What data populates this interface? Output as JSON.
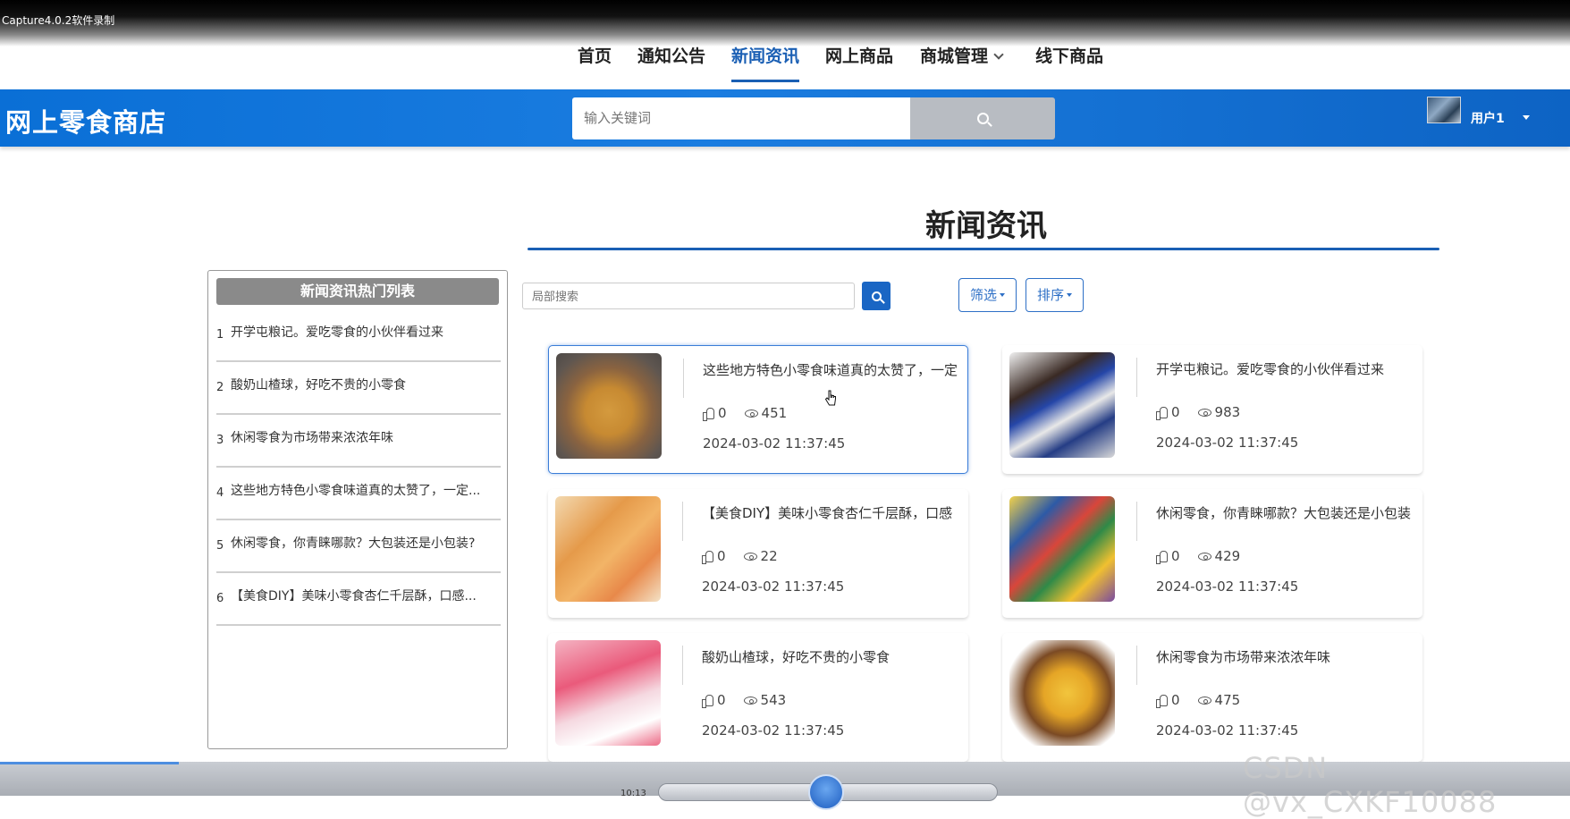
{
  "capture": {
    "title": "Capture4.0.2软件录制"
  },
  "topnav": {
    "items": [
      {
        "label": "首页"
      },
      {
        "label": "通知公告"
      },
      {
        "label": "新闻资讯"
      },
      {
        "label": "网上商品"
      },
      {
        "label": "商城管理"
      },
      {
        "label": "线下商品"
      }
    ],
    "active_index": 2
  },
  "header": {
    "brand": "网上零食商店",
    "search_placeholder": "输入关键词",
    "user_name": "用户1",
    "accent_color": "#0a6fd6"
  },
  "page": {
    "title": "新闻资讯"
  },
  "sidebar": {
    "title": "新闻资讯热门列表",
    "items": [
      {
        "num": "1",
        "text": "开学屯粮记。爱吃零食的小伙伴看过来"
      },
      {
        "num": "2",
        "text": "酸奶山楂球，好吃不贵的小零食"
      },
      {
        "num": "3",
        "text": "休闲零食为市场带来浓浓年味"
      },
      {
        "num": "4",
        "text": "这些地方特色小零食味道真的太赞了，一定..."
      },
      {
        "num": "5",
        "text": "休闲零食，你青睐哪款？大包装还是小包装?"
      },
      {
        "num": "6",
        "text": "【美食DIY】美味小零食杏仁千层酥，口感..."
      }
    ]
  },
  "filters": {
    "search_placeholder": "局部搜索",
    "filter_label": "筛选",
    "sort_label": "排序"
  },
  "news": [
    {
      "title": "这些地方特色小零食味道真的太赞了，一定",
      "likes": "0",
      "views": "451",
      "date": "2024-03-02 11:37:45"
    },
    {
      "title": "开学屯粮记。爱吃零食的小伙伴看过来",
      "likes": "0",
      "views": "983",
      "date": "2024-03-02 11:37:45"
    },
    {
      "title": "【美食DIY】美味小零食杏仁千层酥，口感",
      "likes": "0",
      "views": "22",
      "date": "2024-03-02 11:37:45"
    },
    {
      "title": "休闲零食，你青睐哪款？大包装还是小包装",
      "likes": "0",
      "views": "429",
      "date": "2024-03-02 11:37:45"
    },
    {
      "title": "酸奶山楂球，好吃不贵的小零食",
      "likes": "0",
      "views": "543",
      "date": "2024-03-02 11:37:45"
    },
    {
      "title": "休闲零食为市场带来浓浓年味",
      "likes": "0",
      "views": "475",
      "date": "2024-03-02 11:37:45"
    }
  ],
  "footer": {
    "time": "10:13",
    "watermark": "CSDN @vx_CXKF10088"
  }
}
